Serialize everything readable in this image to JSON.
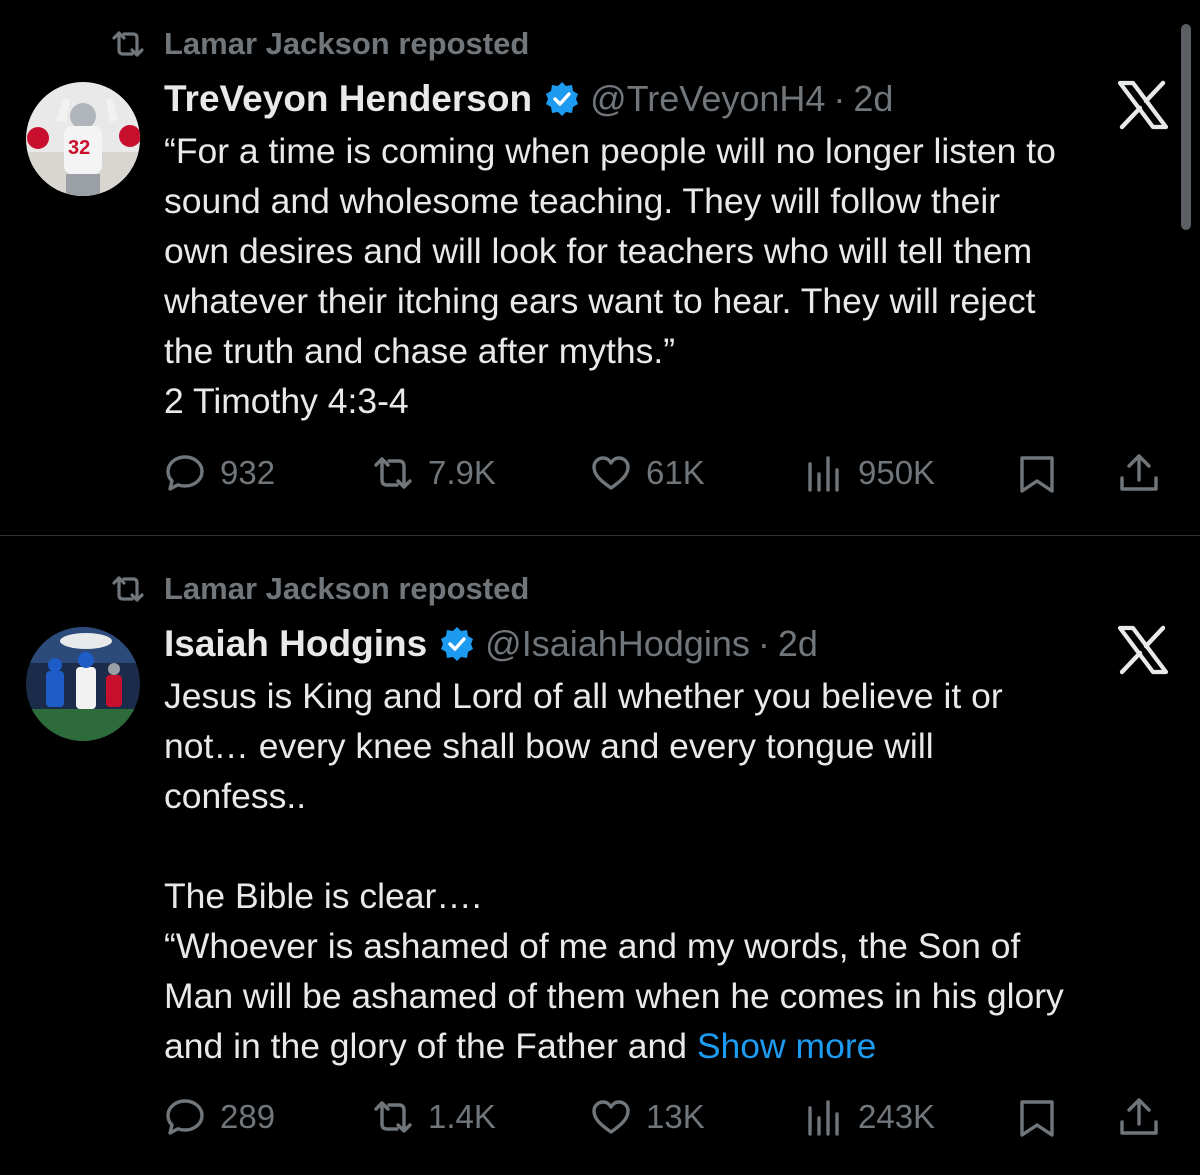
{
  "posts": [
    {
      "reposted_by": "Lamar Jackson reposted",
      "author": {
        "name": "TreVeyon Henderson",
        "handle": "@TreVeyonH4",
        "age": "2d",
        "verified": true
      },
      "text_lines": [
        "“For a time is coming when people will no longer listen to",
        "sound and wholesome teaching. They will follow their",
        "own desires and will look for teachers who will tell them",
        "whatever their itching ears want to hear. They will reject",
        "the truth and chase after myths.”",
        "2 Timothy 4:3-4"
      ],
      "stats": {
        "replies": "932",
        "reposts": "7.9K",
        "likes": "61K",
        "views": "950K"
      }
    },
    {
      "reposted_by": "Lamar Jackson reposted",
      "author": {
        "name": "Isaiah Hodgins",
        "handle": "@IsaiahHodgins",
        "age": "2d",
        "verified": true
      },
      "text_lines": [
        "Jesus is King and Lord of all whether you believe it or",
        "not… every knee shall bow and every tongue will",
        "confess..",
        "",
        "The Bible is clear….",
        "“Whoever is ashamed of me and my words, the Son of",
        "Man will be ashamed of them when he comes in his glory",
        "and in the glory of the Father and"
      ],
      "show_more": "Show more",
      "stats": {
        "replies": "289",
        "reposts": "1.4K",
        "likes": "13K",
        "views": "243K"
      }
    }
  ],
  "separator": "·",
  "icons": {
    "repost": "repost-icon",
    "verified": "verified-badge-icon",
    "x_logo": "x-logo-icon",
    "reply": "reply-icon",
    "like": "heart-icon",
    "views": "views-bar-chart-icon",
    "bookmark": "bookmark-icon",
    "share": "share-icon"
  },
  "colors": {
    "background": "#000000",
    "text": "#e7e9ea",
    "muted": "#71767b",
    "link": "#1d9bf0",
    "verified": "#1d9bf0",
    "divider": "#2f3336"
  }
}
